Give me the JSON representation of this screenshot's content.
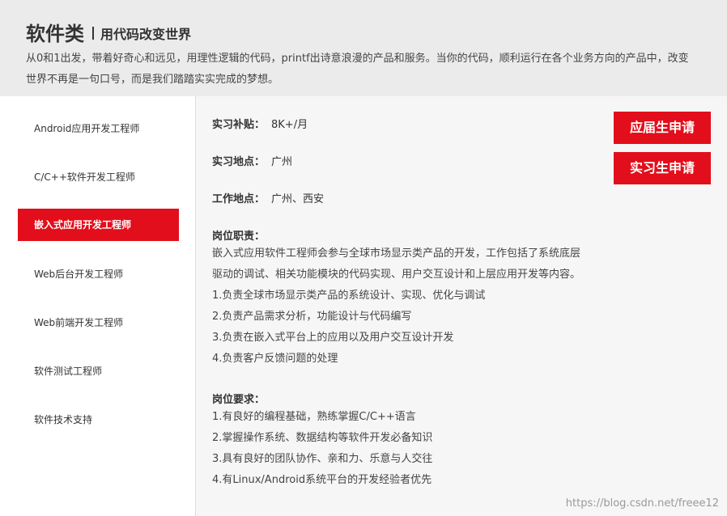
{
  "header": {
    "title": "软件类",
    "subtitle": "用代码改变世界",
    "description": "从0和1出发，带着好奇心和远见，用理性逻辑的代码，printf出诗意浪漫的产品和服务。当你的代码，顺利运行在各个业务方向的产品中，改变世界不再是一句口号，而是我们踏踏实实完成的梦想。"
  },
  "sidebar": {
    "items": [
      {
        "label": "Android应用开发工程师"
      },
      {
        "label": "C/C++软件开发工程师"
      },
      {
        "label": "嵌入式应用开发工程师"
      },
      {
        "label": "Web后台开发工程师"
      },
      {
        "label": "Web前端开发工程师"
      },
      {
        "label": "软件测试工程师"
      },
      {
        "label": "软件技术支持"
      }
    ],
    "active_index": 2
  },
  "job": {
    "salary_label": "实习补贴：",
    "salary_value": "8K+/月",
    "intern_location_label": "实习地点：",
    "intern_location_value": "广州",
    "work_location_label": "工作地点：",
    "work_location_value": "广州、西安",
    "duties_title": "岗位职责：",
    "duties": [
      "嵌入式应用软件工程师会参与全球市场显示类产品的开发，工作包括了系统底层",
      "驱动的调试、相关功能模块的代码实现、用户交互设计和上层应用开发等内容。",
      "1.负责全球市场显示类产品的系统设计、实现、优化与调试",
      "2.负责产品需求分析，功能设计与代码编写",
      "3.负责在嵌入式平台上的应用以及用户交互设计开发",
      "4.负责客户反馈问题的处理"
    ],
    "requirements_title": "岗位要求：",
    "requirements": [
      "1.有良好的编程基础，熟练掌握C/C++语言",
      "2.掌握操作系统、数据结构等软件开发必备知识",
      "3.具有良好的团队协作、亲和力、乐意与人交往",
      "4.有Linux/Android系统平台的开发经验者优先"
    ]
  },
  "buttons": {
    "graduate_apply": "应届生申请",
    "intern_apply": "实习生申请"
  },
  "watermark": "https://blog.csdn.net/freee12",
  "colors": {
    "accent": "#e30e1b",
    "header_bg": "#ebebeb",
    "sidebar_bg": "#ffffff"
  }
}
